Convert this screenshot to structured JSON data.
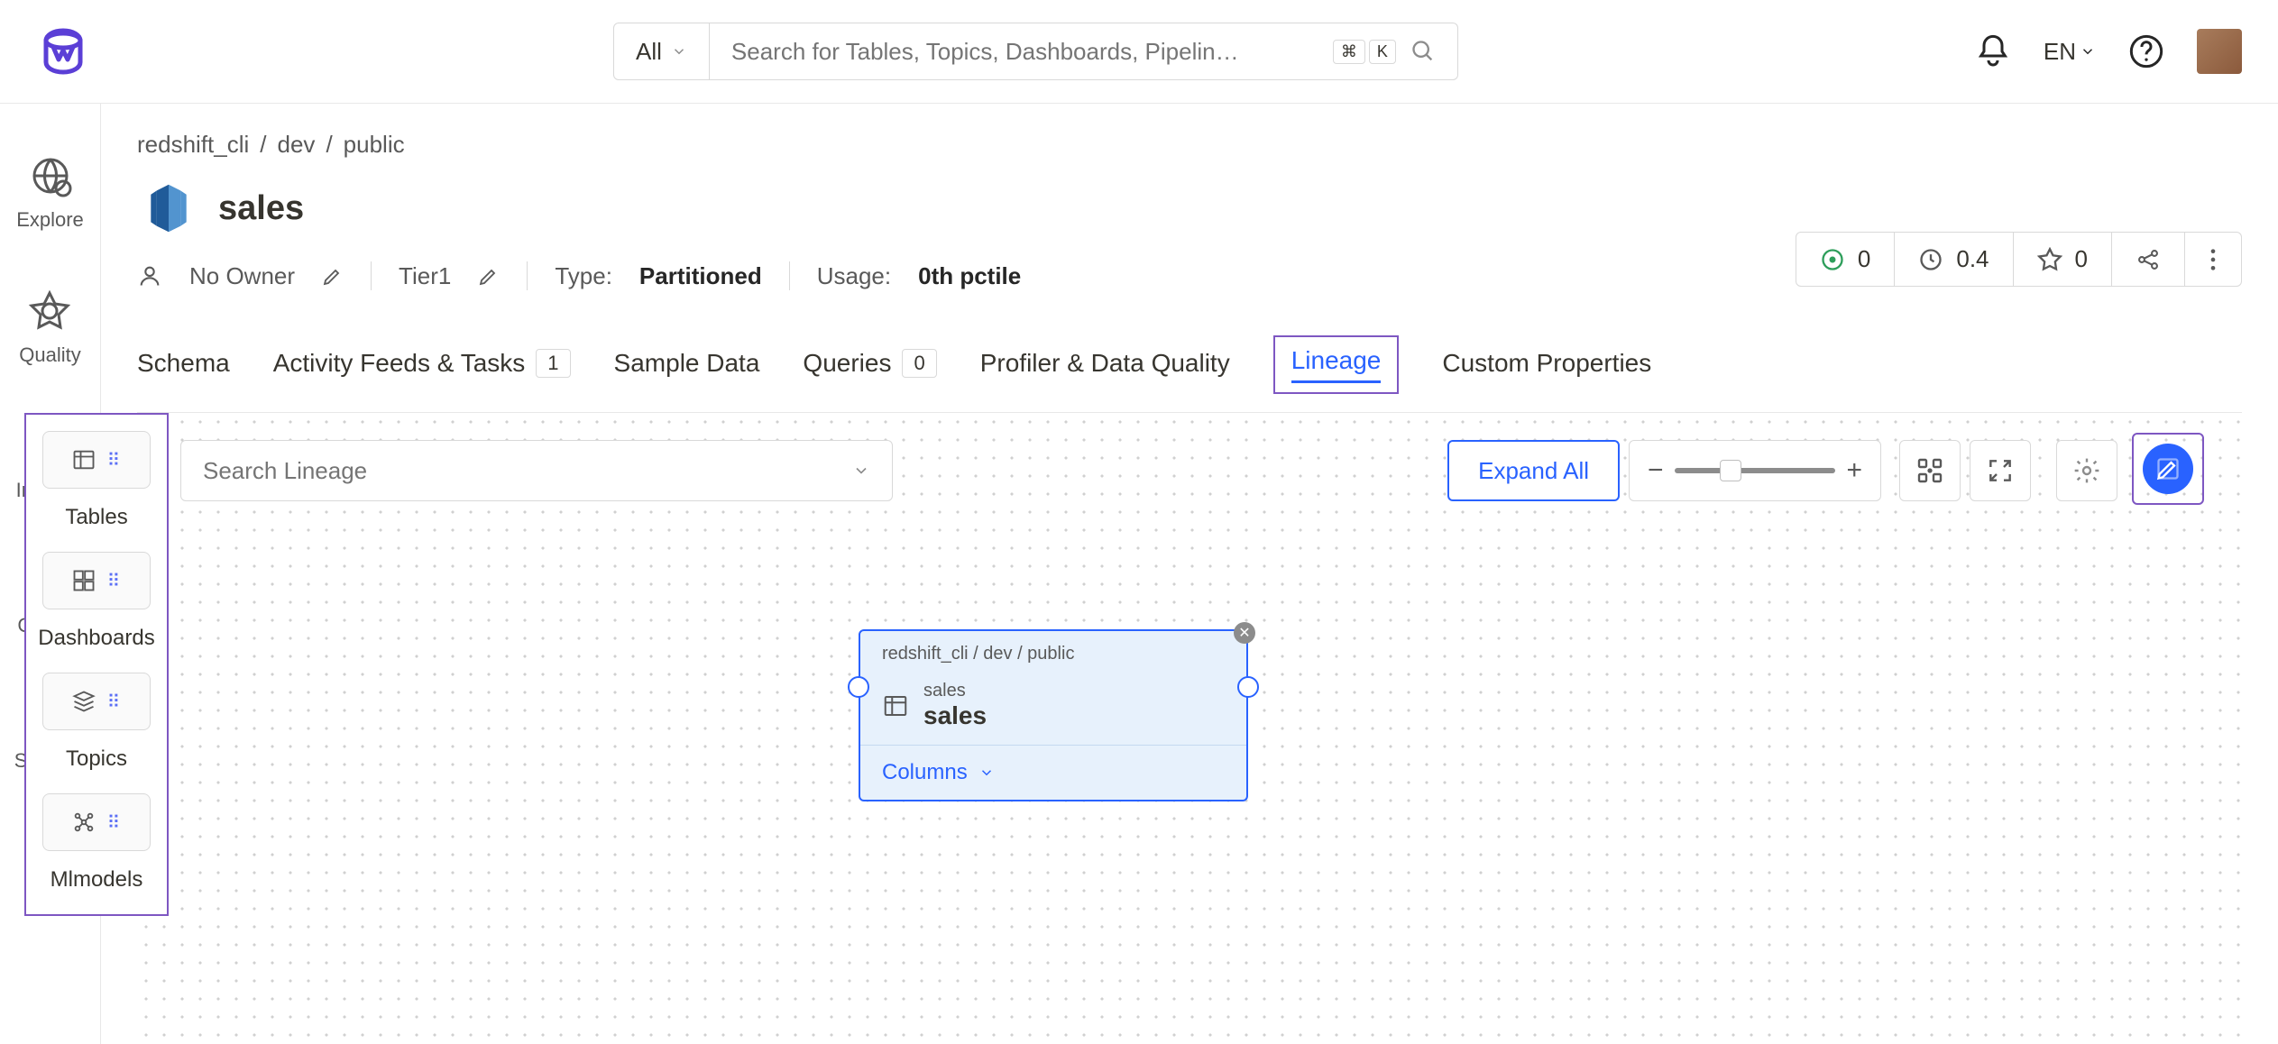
{
  "header": {
    "filter_label": "All",
    "search_placeholder": "Search for Tables, Topics, Dashboards, Pipelin…",
    "kbd1": "⌘",
    "kbd2": "K",
    "language": "EN"
  },
  "rail": {
    "explore": "Explore",
    "quality": "Quality",
    "insights": "Insights",
    "govern": "Govern",
    "settings": "Settings"
  },
  "breadcrumb": [
    "redshift_cli",
    "dev",
    "public"
  ],
  "entity": {
    "name": "sales",
    "owner_label": "No Owner",
    "tier": "Tier1",
    "type_label": "Type:",
    "type_value": "Partitioned",
    "usage_label": "Usage:",
    "usage_value": "0th pctile"
  },
  "stats": {
    "issues": "0",
    "runs": "0.4",
    "stars": "0"
  },
  "tabs": {
    "schema": "Schema",
    "activity": "Activity Feeds & Tasks",
    "activity_count": "1",
    "sample": "Sample Data",
    "queries": "Queries",
    "queries_count": "0",
    "profiler": "Profiler & Data Quality",
    "lineage": "Lineage",
    "custom": "Custom Properties"
  },
  "tools": {
    "tables": "Tables",
    "dashboards": "Dashboards",
    "topics": "Topics",
    "mlmodels": "Mlmodels"
  },
  "lineage": {
    "search_placeholder": "Search Lineage",
    "expand_all": "Expand All"
  },
  "node": {
    "breadcrumb": "redshift_cli / dev / public",
    "subtitle": "sales",
    "title": "sales",
    "columns": "Columns"
  }
}
